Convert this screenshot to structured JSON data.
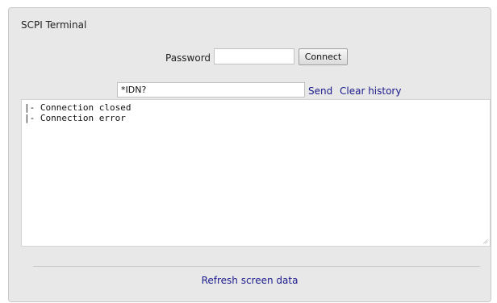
{
  "panel": {
    "title": "SCPI Terminal"
  },
  "auth": {
    "password_label": "Password",
    "password_value": "",
    "connect_label": "Connect"
  },
  "command": {
    "value": "*IDN?",
    "send_label": "Send",
    "clear_label": "Clear history"
  },
  "terminal": {
    "lines": [
      "|- Connection closed",
      "|- Connection error"
    ]
  },
  "footer": {
    "refresh_label": "Refresh screen data"
  },
  "colors": {
    "panel_bg": "#e8e8e8",
    "link": "#1a1a8c"
  }
}
